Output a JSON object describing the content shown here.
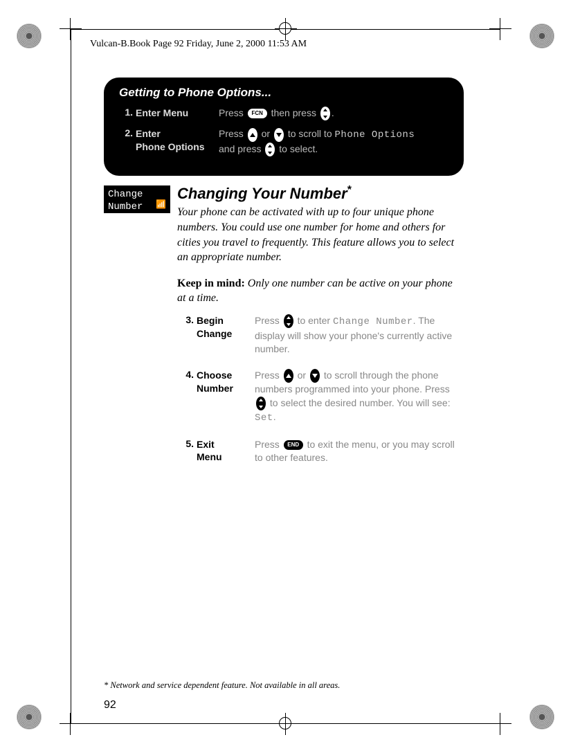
{
  "running_head": "Vulcan-B.Book  Page 92  Friday, June 2, 2000  11:53 AM",
  "box": {
    "title": "Getting to Phone Options...",
    "steps": [
      {
        "num": "1.",
        "label": "Enter Menu",
        "desc_pre": "Press ",
        "key1": "FCN",
        "desc_mid": " then press ",
        "desc_post": "."
      },
      {
        "num": "2.",
        "label": "Enter\nPhone Options",
        "desc_pre": "Press ",
        "desc_or": " or ",
        "desc_mid": " to scroll to ",
        "mono1": "Phone Options",
        "desc_line2_pre": "and press ",
        "desc_line2_post": " to select."
      }
    ]
  },
  "screen_label": "Change\nNumber",
  "section": {
    "title": "Changing Your Number",
    "asterisk": "*",
    "para1": "Your phone can be activated with up to four unique phone numbers. You could use one number for home and others for cities you travel to frequently. This feature allows you to select an appropriate number.",
    "para2_bold": "Keep in mind:",
    "para2_rest": " Only one number can be active on your phone at a time."
  },
  "steps_white": [
    {
      "num": "3.",
      "label": "Begin\nChange",
      "pre": "Press ",
      "mid1": " to enter ",
      "mono1": "Change Number",
      "post1": ". The display will show your phone's currently active number."
    },
    {
      "num": "4.",
      "label": "Choose\nNumber",
      "pre": "Press ",
      "or": " or ",
      "mid1": " to scroll through the phone numbers programmed into your phone. Press ",
      "mid2": " to select the desired number. You will see: ",
      "mono1": "Set",
      "post": "."
    },
    {
      "num": "5.",
      "label": "Exit\nMenu",
      "pre": "Press ",
      "key1": "END",
      "post": " to exit the menu, or you may scroll to other features."
    }
  ],
  "footnote": "* Network and service dependent feature. Not available in all areas.",
  "page_number": "92"
}
